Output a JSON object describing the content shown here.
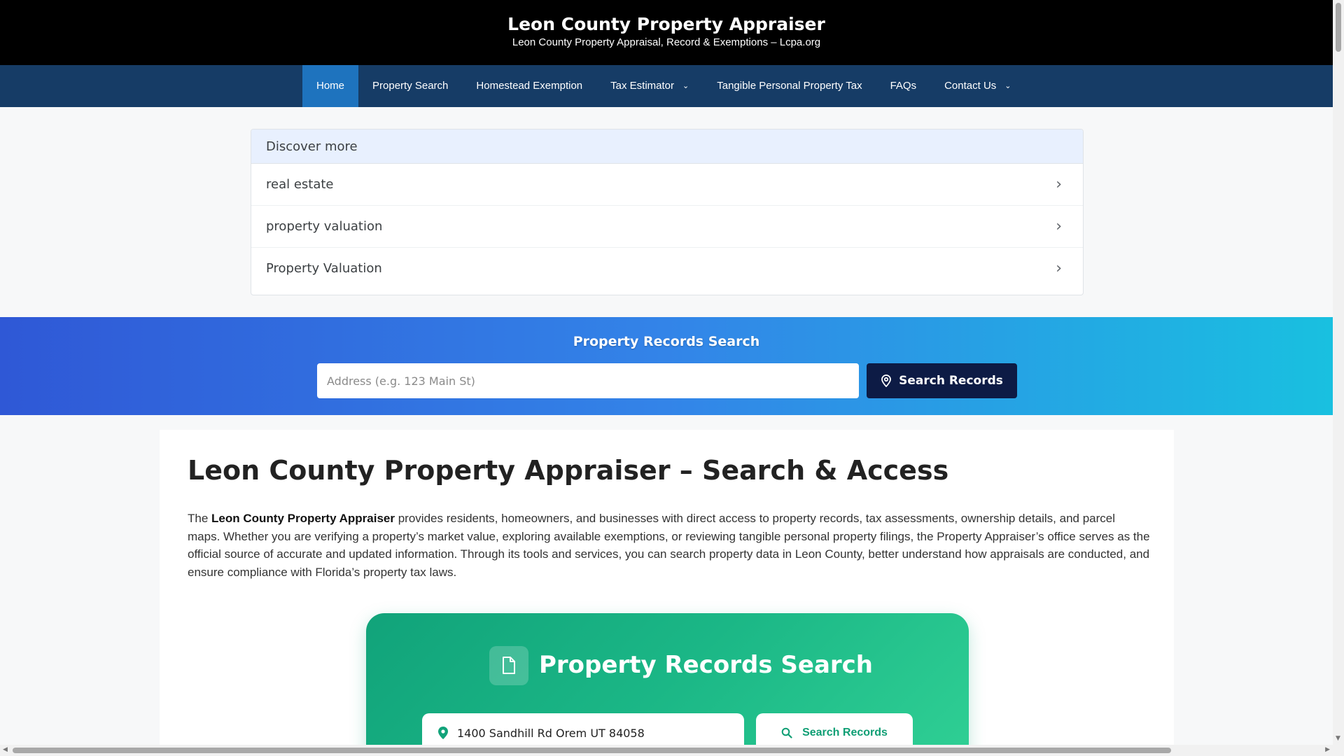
{
  "header": {
    "title": "Leon County Property Appraiser",
    "tagline": "Leon County Property Appraisal, Record & Exemptions – Lcpa.org"
  },
  "nav": {
    "items": [
      {
        "label": "Home",
        "active": true
      },
      {
        "label": "Property Search"
      },
      {
        "label": "Homestead Exemption"
      },
      {
        "label": "Tax Estimator",
        "dropdown": true
      },
      {
        "label": "Tangible Personal Property Tax"
      },
      {
        "label": "FAQs"
      },
      {
        "label": "Contact Us",
        "dropdown": true
      }
    ]
  },
  "discover": {
    "heading": "Discover more",
    "items": [
      "real estate",
      "property valuation",
      "Property Valuation"
    ]
  },
  "banner": {
    "title": "Property Records Search",
    "placeholder": "Address (e.g. 123 Main St)",
    "button": "Search Records"
  },
  "article": {
    "title": "Leon County Property Appraiser – Search & Access",
    "intro_prefix": "The ",
    "intro_bold": "Leon County Property Appraiser",
    "intro_rest": " provides residents, homeowners, and businesses with direct access to property records, tax assessments, ownership details, and parcel maps. Whether you are verifying a property’s market value, exploring available exemptions, or reviewing tangible personal property filings, the Property Appraiser’s office serves as the official source of accurate and updated information. Through its tools and services, you can search property data in Leon County, better understand how appraisals are conducted, and ensure compliance with Florida’s property tax laws."
  },
  "card": {
    "title": "Property Records Search",
    "address_value": "1400 Sandhill Rd Orem UT 84058",
    "button": "Search Records"
  },
  "colors": {
    "header_bg": "#000000",
    "nav_bg": "#163c66",
    "nav_active": "#1e73be",
    "banner_button": "#0d1b45",
    "card_green": "#1bb786"
  },
  "icons": {
    "nav_dropdown": "chevron-down-icon",
    "discover_arrow": "chevron-right-icon",
    "banner_button": "map-pin-icon",
    "card_header": "document-icon",
    "card_input": "location-pin-icon",
    "card_button": "search-icon"
  }
}
